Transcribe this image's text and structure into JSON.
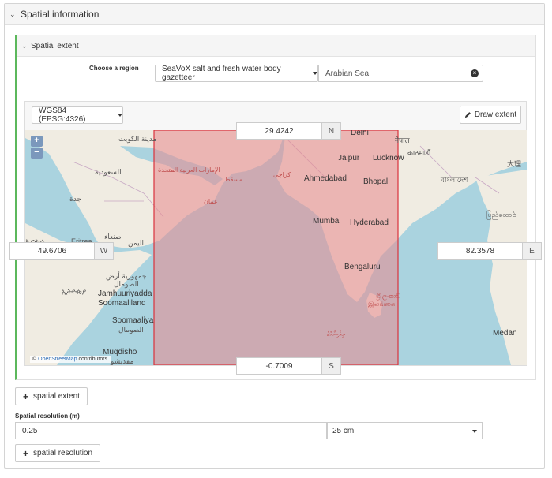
{
  "outer_panel": {
    "title": "Spatial information"
  },
  "spatial_extent": {
    "title": "Spatial extent",
    "region_label": "Choose a region",
    "gazetteer_label": "SeaVoX salt and fresh water body gazetteer",
    "region_value": "Arabian Sea",
    "crs_label": "WGS84 (EPSG:4326)",
    "draw_extent_label": "Draw extent",
    "north": {
      "value": "29.4242",
      "dir": "N"
    },
    "south": {
      "value": "-0.7009",
      "dir": "S"
    },
    "west": {
      "value": "49.6706",
      "dir": "W"
    },
    "east": {
      "value": "82.3578",
      "dir": "E"
    },
    "zoom_in": "+",
    "zoom_out": "−",
    "attribution": {
      "prefix": "©",
      "link": "OpenStreetMap",
      "suffix": "contributors."
    },
    "selection_color": "#e8888c",
    "map_labels": {
      "kuwait": "مدينة الكويت",
      "uae": "الإمارات العربية المتحدة",
      "saudi": "السعودية",
      "muscat": "مسقط",
      "karachi": "كراچی",
      "oman": "عمان",
      "jeddah": "جدة",
      "yemen": "اليمن",
      "sanaa": "صنعاء",
      "eritrea": "Eritrea",
      "eritrea_ar": "ኤርትራ",
      "somalia_ar": "جمهورية أرض",
      "somali": "الصومال",
      "ethiopia": "ኢትዮጵያ",
      "jamhuuriyadda": "Jamhuuriyadda",
      "soomaaliland": "Soomaaliland",
      "soomaaliya": "Soomaaliya",
      "soomaaliya_ar": "الصومال",
      "muqdisho": "Muqdisho",
      "muqdisho_ar": "مقديشو",
      "delhi": "Delhi",
      "nepal": "नेपाल",
      "kathmandu": "काठमाडौं",
      "jaipur": "Jaipur",
      "lucknow": "Lucknow",
      "ahmedabad": "Ahmedabad",
      "bhopal": "Bhopal",
      "bangladesh": "বাংলাদেশ",
      "myanmar": "ပြည်ထောင်",
      "mumbai": "Mumbai",
      "hyderabad": "Hyderabad",
      "bengaluru": "Bengaluru",
      "srilanka": "ශ්‍රී ලංකාව",
      "srilanka2": "இலங்கை",
      "maldives": "ދިވެހިރާއްޖެ",
      "medan": "Medan",
      "china": "大理"
    }
  },
  "add_extent_label": "spatial extent",
  "resolution": {
    "label": "Spatial resolution (m)",
    "value": "0.25",
    "unit_selected": "25 cm",
    "add_label": "spatial resolution"
  }
}
